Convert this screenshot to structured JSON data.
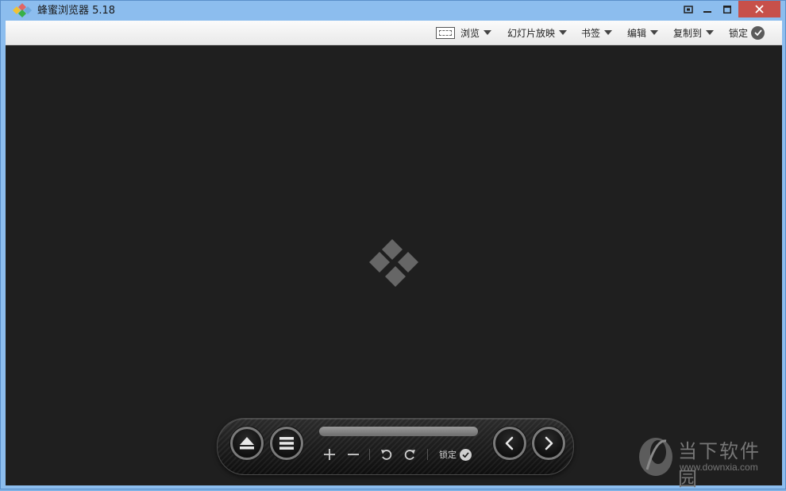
{
  "window": {
    "title": "蜂蜜浏览器 5.18"
  },
  "toolbar": {
    "browse_label": "浏览",
    "slideshow_label": "幻灯片放映",
    "bookmark_label": "书签",
    "edit_label": "编辑",
    "copy_to_label": "复制到",
    "lock_label": "锁定"
  },
  "controls": {
    "lock_label": "锁定",
    "icons": [
      "eject-icon",
      "menu-icon",
      "zoom-in-icon",
      "zoom-out-icon",
      "rotate-left-icon",
      "rotate-right-icon",
      "prev-icon",
      "next-icon"
    ]
  },
  "watermark": {
    "brand": "当下软件园",
    "url": "www.downxia.com"
  },
  "colors": {
    "titlebar": "#8cbdee",
    "close_button": "#c7504a",
    "viewer_bg": "#1f1f1f",
    "logo_gray": "#666666"
  }
}
